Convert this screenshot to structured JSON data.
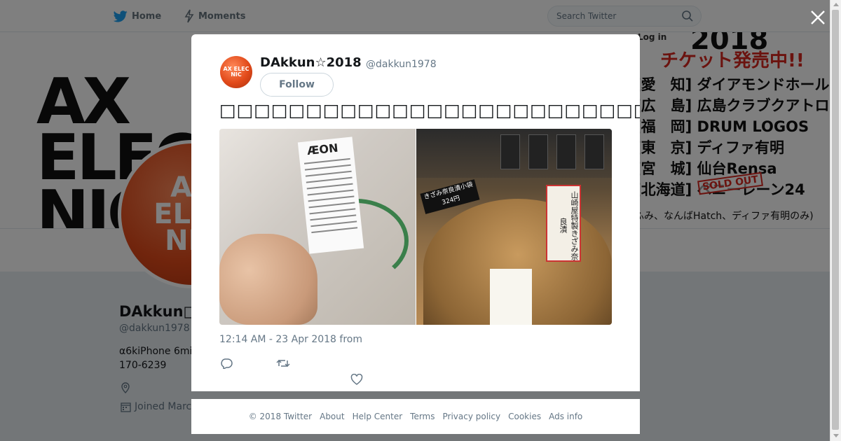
{
  "nav": {
    "home_label": "Home",
    "moments_label": "Moments",
    "search_placeholder": "Search Twitter",
    "login_label": "Log in"
  },
  "banner": {
    "left_text": "AX\nELEC\nNIC",
    "year": "2018",
    "ticket_text": "チケット発売中!!",
    "venues": [
      "[愛　知] ダイアモンドホール",
      "[広　島] 広島クラブクアトロ",
      "[福　岡] DRUM LOGOS",
      "[東　京] ディファ有明",
      "[宮　城] 仙台Rensa",
      "[北海道] ペニーレーン24"
    ],
    "soldout_label": "SOLD OUT",
    "note": "ふみ、なんばHatch、ディファ有明のみ)"
  },
  "profile": {
    "name": "DAkkun",
    "handle": "@dakkun1978",
    "bio": "α6kiPhone 6mi 170-6239",
    "joined": "Joined Marc"
  },
  "tweet": {
    "avatar_text": "AX ELEC NIC",
    "name": "DAkkun☆2018",
    "handle": "@dakkun1978",
    "follow_label": "Follow",
    "text": "□□□□□□□□□□□□□□□□□□□□□□□□□□□□□□□□□□□□",
    "timestamp": "12:14 AM - 23 Apr 2018 from",
    "photo_left": {
      "logo": "ÆON"
    },
    "photo_right": {
      "price_card": "きざみ奈良漬小袋 324円",
      "sign": "山崎屋特製きざみ奈良漬"
    }
  },
  "footer": {
    "links": [
      "© 2018 Twitter",
      "About",
      "Help Center",
      "Terms",
      "Privacy policy",
      "Cookies",
      "Ads info"
    ]
  },
  "icons": {
    "home": "bird-icon",
    "moments": "lightning-icon",
    "search": "search-icon",
    "close": "close-icon",
    "reply": "reply-icon",
    "retweet": "retweet-icon",
    "like": "heart-icon",
    "location": "location-icon",
    "calendar": "calendar-icon"
  },
  "colors": {
    "twitter_blue": "#1da1f2",
    "overlay": "rgba(0,0,0,0.5)",
    "text_dark": "#14171a",
    "text_muted": "#657786",
    "brand_orange": "#e24a1a",
    "ticket_red": "#d7261e"
  }
}
